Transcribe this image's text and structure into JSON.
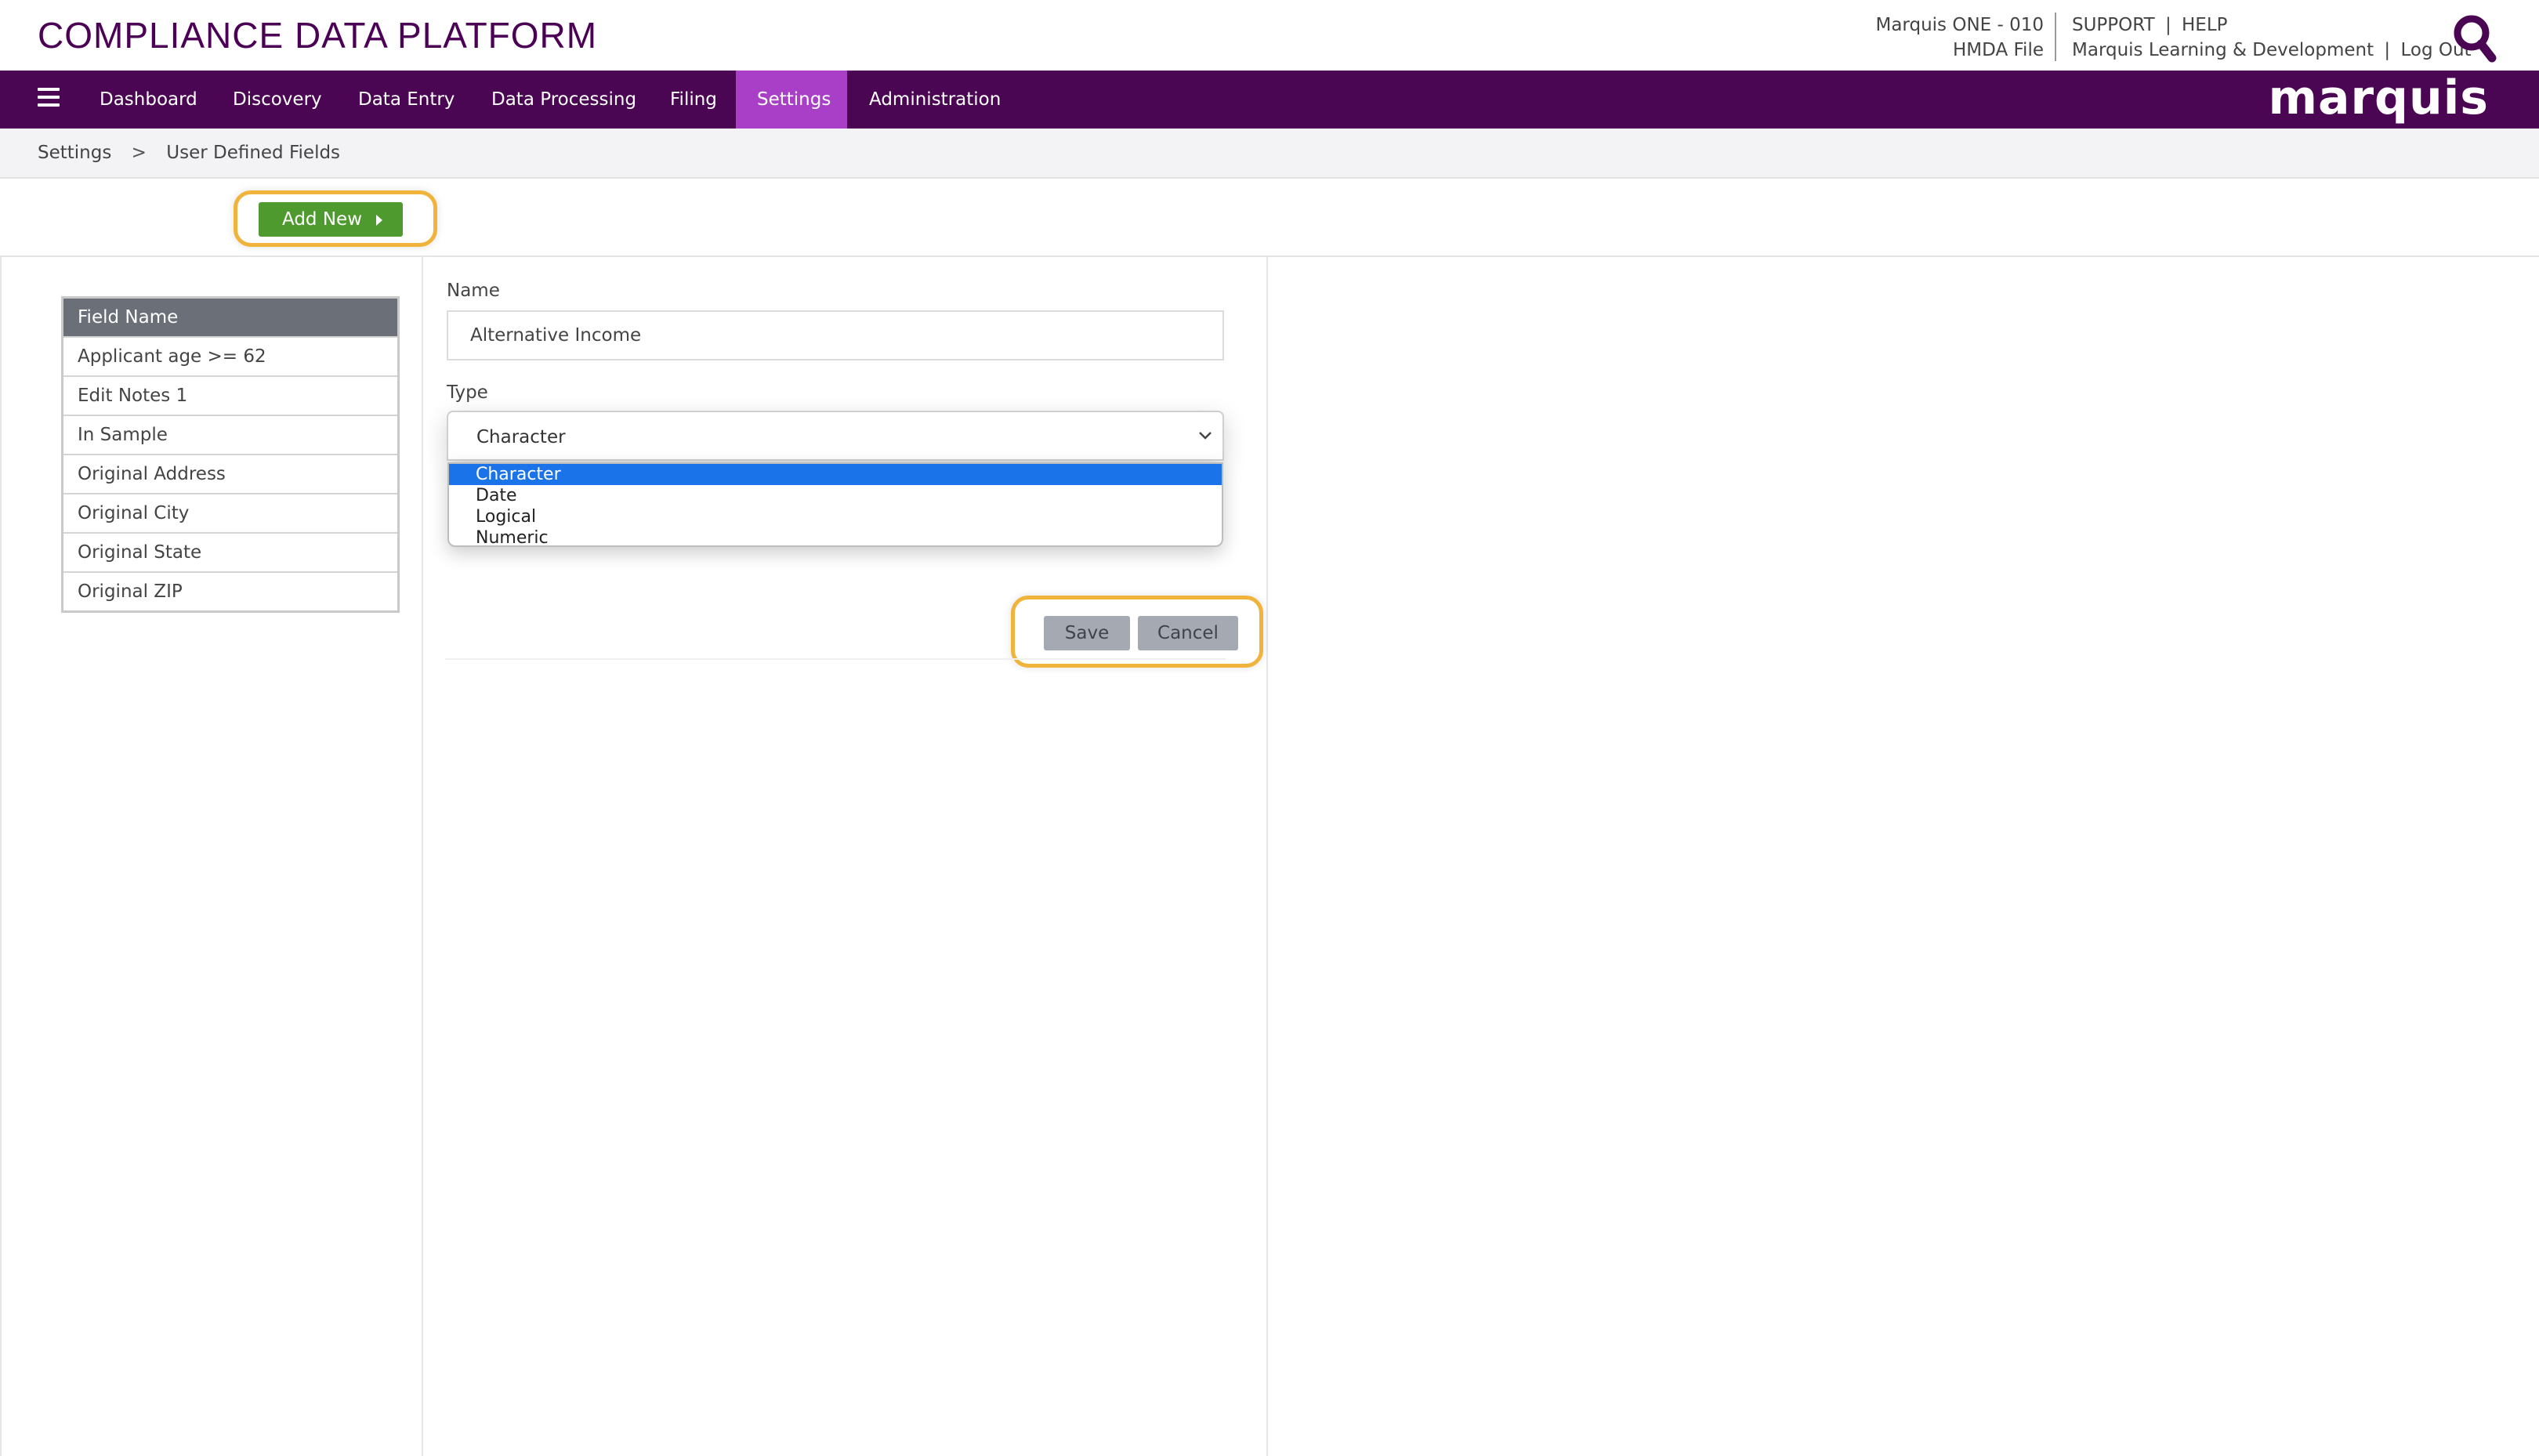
{
  "app": {
    "title": "COMPLIANCE DATA PLATFORM",
    "logo": "marquis"
  },
  "header": {
    "org_line": "Marquis ONE - 010",
    "file_line": "HMDA File",
    "support": "SUPPORT",
    "help": "HELP",
    "pipe": "|",
    "user": "Marquis Learning & Development",
    "logout": "Log Out"
  },
  "nav": {
    "items": [
      {
        "label": "Dashboard"
      },
      {
        "label": "Discovery"
      },
      {
        "label": "Data Entry"
      },
      {
        "label": "Data Processing"
      },
      {
        "label": "Filing"
      },
      {
        "label": "Settings",
        "active": true
      },
      {
        "label": "Administration"
      }
    ]
  },
  "breadcrumb": {
    "items": [
      "Settings",
      "User Defined Fields"
    ],
    "separator": ">"
  },
  "toolbar": {
    "add_new_label": "Add New"
  },
  "field_list": {
    "header": "Field Name",
    "rows": [
      "Applicant age >= 62",
      "Edit Notes 1",
      "In Sample",
      "Original Address",
      "Original City",
      "Original State",
      "Original ZIP"
    ]
  },
  "form": {
    "name_label": "Name",
    "name_value": "Alternative Income",
    "type_label": "Type",
    "type_value": "Character",
    "type_options": [
      "Character",
      "Date",
      "Logical",
      "Numeric"
    ],
    "save_label": "Save",
    "cancel_label": "Cancel"
  },
  "colors": {
    "brand_purple": "#4a0653",
    "active_tab": "#a93fc7",
    "add_button": "#4e9a2e",
    "highlight_ring": "#f0b33b",
    "selected_option": "#1a73e8"
  },
  "icons": {
    "search": "search-icon",
    "menu": "hamburger-menu-icon",
    "dropdown": "chevron-down-icon",
    "add_caret": "caret-right-icon"
  }
}
